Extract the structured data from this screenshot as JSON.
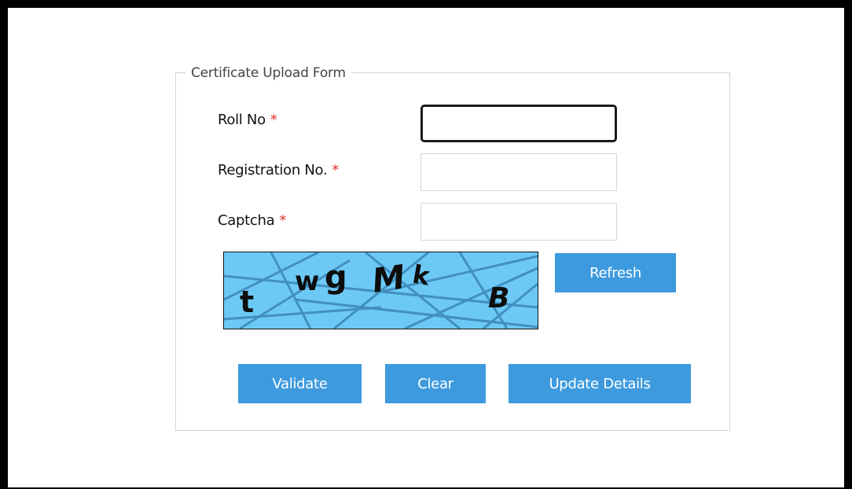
{
  "form": {
    "legend": "Certificate Upload Form",
    "required_mark": "*",
    "fields": [
      {
        "label": "Roll No",
        "value": "",
        "placeholder": ""
      },
      {
        "label": "Registration No.",
        "value": "",
        "placeholder": ""
      },
      {
        "label": "Captcha",
        "value": "",
        "placeholder": ""
      }
    ],
    "captcha_text": {
      "c1": "t",
      "c2": "w",
      "c3": "g",
      "c4": "M",
      "c5": "k",
      "c6": "B"
    },
    "captcha_colors": {
      "background": "#6cc9f5",
      "lines": "#3b86b6",
      "text": "#0d0d0d"
    },
    "buttons": {
      "refresh": "Refresh",
      "validate": "Validate",
      "clear": "Clear",
      "update": "Update Details"
    },
    "colors": {
      "button": "#3e9ade",
      "required": "#e0322b"
    }
  }
}
